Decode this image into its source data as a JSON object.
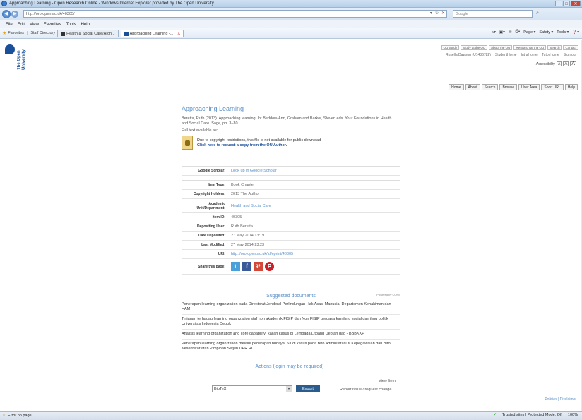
{
  "window": {
    "title": "Approaching Learning - Open Research Online - Windows Internet Explorer provided by The Open University",
    "min": "–",
    "max": "□",
    "close": "✕"
  },
  "address": {
    "url": "http://oro.open.ac.uk/40305/",
    "search_placeholder": "Google"
  },
  "menu": [
    "File",
    "Edit",
    "View",
    "Favorites",
    "Tools",
    "Help"
  ],
  "favorites": {
    "label": "Favorites",
    "items": [
      "Staff Directory"
    ],
    "tabs": [
      {
        "label": "Health & Social Care/Arch..."
      },
      {
        "label": "Approaching Learning -...",
        "close": "X"
      }
    ]
  },
  "commands": [
    "Page ▾",
    "Safety ▾",
    "Tools ▾",
    "❓▾"
  ],
  "site": {
    "logo_text": "The Open University",
    "top_links": [
      "OU Study",
      "Study at the OU",
      "About the OU",
      "Research at the OU",
      "Search",
      "Contact"
    ],
    "user_line": [
      "Rosella Dawson (U1436782)",
      "StudentHome",
      "IntraHome",
      "TutorHome",
      "Sign out"
    ],
    "accessibility": {
      "label": "Accessibility",
      "buttons": [
        "A",
        "A",
        "A"
      ]
    },
    "nav": [
      "Home",
      "About",
      "Search",
      "Browse",
      "User Area",
      "Short URL",
      "Help"
    ]
  },
  "item": {
    "title": "Approaching Learning",
    "citation": "Beretta, Ruth (2013). Approaching learning. In: Beddow-Ann, Graham and Barker, Steven eds. Your Foundations in Health and Social Care. Sage, pp. 3–30.",
    "fulltext_label": "Full text available as:",
    "restriction": "Due to copyright restrictions, this file is not available for public download",
    "request_link": "Click here to request a copy from the OU Author.",
    "google_scholar": {
      "key": "Google Scholar:",
      "value": "Look up in Google Scholar"
    },
    "metadata": [
      {
        "key": "Item Type:",
        "value": "Book Chapter"
      },
      {
        "key": "Copyright Holders:",
        "value": "2013 The Author"
      },
      {
        "key": "Academic Unit/Department:",
        "value": "Health and Social Care",
        "link": true
      },
      {
        "key": "Item ID:",
        "value": "40305"
      },
      {
        "key": "Depositing User:",
        "value": "Ruth Beretta"
      },
      {
        "key": "Date Deposited:",
        "value": "27 May 2014 13:19"
      },
      {
        "key": "Last Modified:",
        "value": "27 May 2014 23:23"
      },
      {
        "key": "URI:",
        "value": "http://oro.open.ac.uk/id/eprint/40305",
        "link": true
      }
    ],
    "share_label": "Share this page:"
  },
  "suggested": {
    "title": "Suggested documents",
    "powered": "Powered by CORE",
    "items": [
      "Penerapan learning organization pada Direktorat Jenderal Perlindungan Hak Asasi Manusia, Departemen Kehakiman dan HAM",
      "Tinjauan terhadap learning organization staf non akademik FISIP dan Non FISIP berdasarkan ilmu sosial dan ilmu politik Universitas Indonesia Depok",
      "Analisis learning organization and core capability: kajian kasus di Lembaga Litbang Deptan dag - BBBKKP",
      "Penerapan learning organization melalui penerapan budaya: Studi kasus pada Biro Administrasi & Kepegawaian dan Biro Kesekretariatan Pimpinan Setjen DPR RI"
    ]
  },
  "actions": {
    "title": "Actions (login may be required)",
    "view_item": "View Item",
    "export_value": "BibTeX",
    "export_button": "Export",
    "report": "Report issue / request change"
  },
  "footer": {
    "text": "Policies | Disclaimer"
  },
  "status": {
    "left": "Error on page.",
    "trusted": "Trusted sites | Protected Mode: Off",
    "zoom": "100%"
  }
}
